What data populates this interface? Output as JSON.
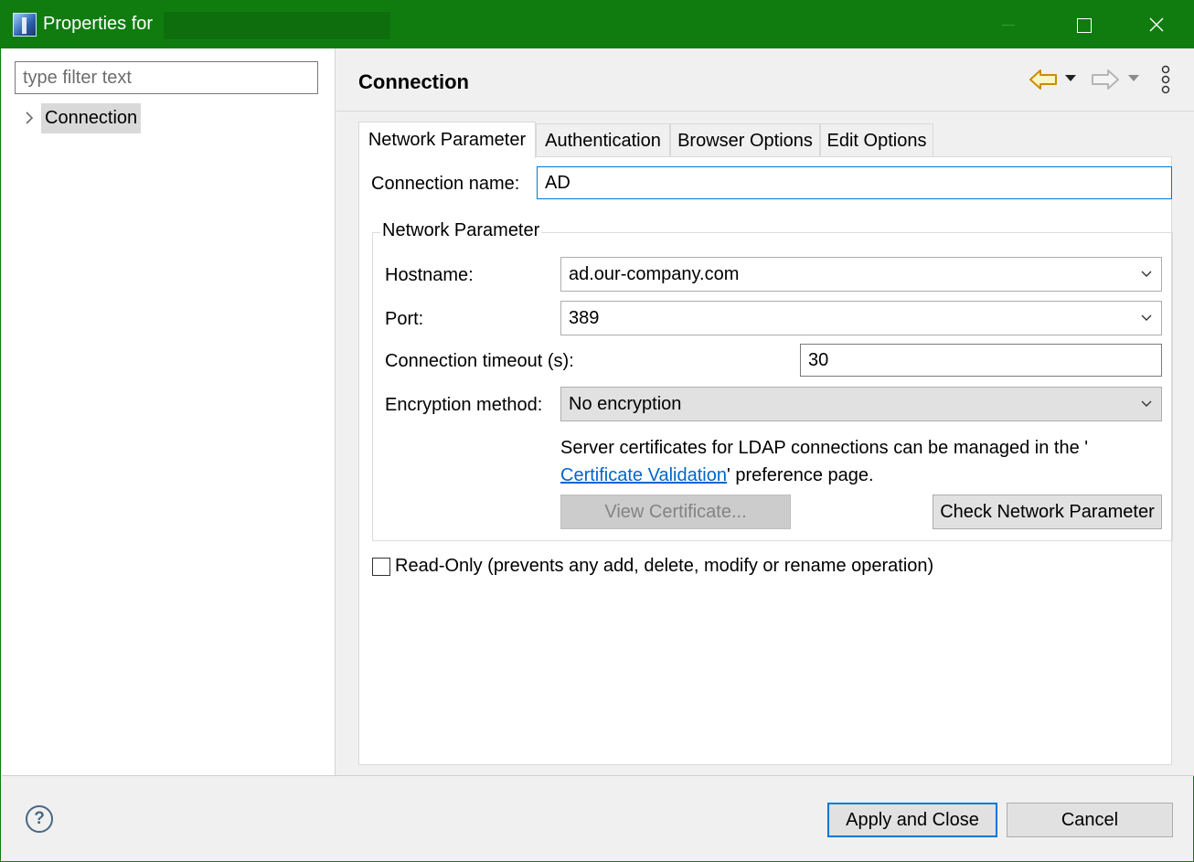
{
  "window": {
    "title": "Properties for",
    "minimize_label": "Minimize",
    "maximize_label": "Maximize",
    "close_label": "Close"
  },
  "sidebar": {
    "filter_placeholder": "type filter text",
    "filter_value": "",
    "items": [
      {
        "label": "Connection",
        "selected": true,
        "expandable": true
      }
    ]
  },
  "page": {
    "title": "Connection",
    "nav": {
      "back_icon": "arrow-left-icon",
      "forward_icon": "arrow-right-icon",
      "menu_icon": "vertical-dots-icon"
    },
    "tabs": [
      {
        "label": "Network Parameter",
        "active": true
      },
      {
        "label": "Authentication",
        "active": false
      },
      {
        "label": "Browser Options",
        "active": false
      },
      {
        "label": "Edit Options",
        "active": false
      }
    ],
    "connection_name_label": "Connection name:",
    "connection_name_value": "AD",
    "group": {
      "title": "Network Parameter",
      "hostname_label": "Hostname:",
      "hostname_value": "ad.our-company.com",
      "port_label": "Port:",
      "port_value": "389",
      "timeout_label": "Connection timeout (s):",
      "timeout_value": "30",
      "encryption_label": "Encryption method:",
      "encryption_value": "No encryption",
      "cert_text_1": "Server certificates for LDAP connections can be managed in the '",
      "cert_link": "Certificate Validation",
      "cert_text_2": "' preference page.",
      "view_cert_button": "View Certificate...",
      "check_button": "Check Network Parameter"
    },
    "readonly_label": "Read-Only (prevents any add, delete, modify or rename operation)",
    "readonly_checked": false
  },
  "footer": {
    "help_icon": "help-icon",
    "apply_button": "Apply and Close",
    "cancel_button": "Cancel"
  },
  "colors": {
    "titlebar": "#107c10",
    "focus_border": "#0078d7",
    "link": "#0066cc",
    "back_arrow": "#d9a300"
  }
}
